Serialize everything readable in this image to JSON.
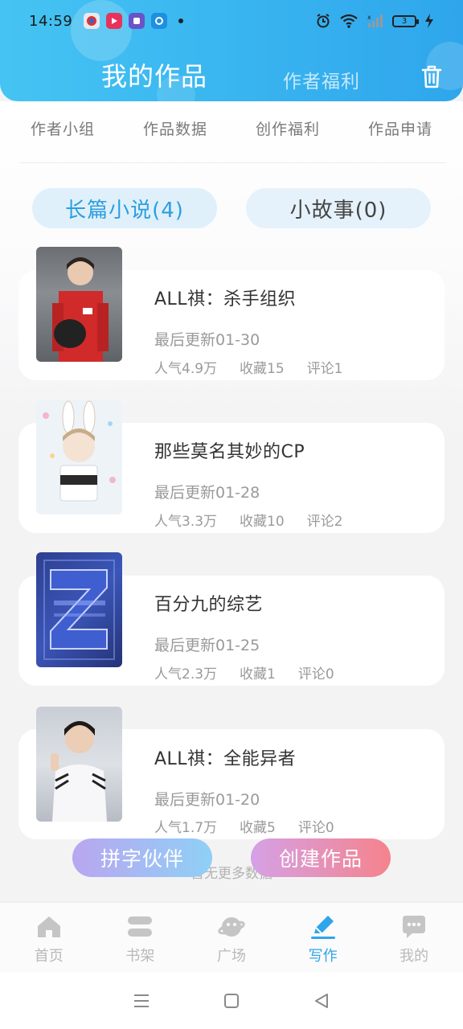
{
  "status_bar": {
    "time": "14:59",
    "battery": "3"
  },
  "header": {
    "title": "我的作品",
    "tab_benefits": "作者福利"
  },
  "menu": [
    "作者小组",
    "作品数据",
    "创作福利",
    "作品申请"
  ],
  "tabs": {
    "novel": "长篇小说(4)",
    "story": "小故事(0)"
  },
  "works": [
    {
      "title": "ALL祺：杀手组织",
      "updated": "最后更新01-30",
      "popularity": "人气4.9万",
      "favorites": "收藏15",
      "comments": "评论1"
    },
    {
      "title": "那些莫名其妙的CP",
      "updated": "最后更新01-28",
      "popularity": "人气3.3万",
      "favorites": "收藏10",
      "comments": "评论2"
    },
    {
      "title": "百分九的综艺",
      "updated": "最后更新01-25",
      "popularity": "人气2.3万",
      "favorites": "收藏1",
      "comments": "评论0"
    },
    {
      "title": "ALL祺：全能异者",
      "updated": "最后更新01-20",
      "popularity": "人气1.7万",
      "favorites": "收藏5",
      "comments": "评论0"
    }
  ],
  "no_more": "暂无更多数据",
  "fab": {
    "partner": "拼字伙伴",
    "create": "创建作品"
  },
  "bottom_nav": [
    {
      "label": "首页",
      "icon": "home-icon"
    },
    {
      "label": "书架",
      "icon": "bookshelf-icon"
    },
    {
      "label": "广场",
      "icon": "planet-icon"
    },
    {
      "label": "写作",
      "icon": "pencil-icon"
    },
    {
      "label": "我的",
      "icon": "chat-bubble-icon"
    }
  ],
  "colors": {
    "accent": "#2fa5ea",
    "header": "#3db8f0",
    "create": "#f5838c"
  }
}
